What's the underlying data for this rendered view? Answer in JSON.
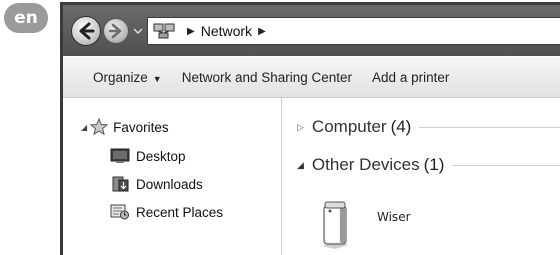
{
  "badge": {
    "language": "en"
  },
  "address_bar": {
    "crumbs": [
      "Network"
    ],
    "icons": [
      "back-arrow-icon",
      "forward-arrow-icon",
      "network-icon",
      "chevron-right-icon"
    ]
  },
  "toolbar": {
    "organize_label": "Organize",
    "network_center_label": "Network and Sharing Center",
    "add_printer_label": "Add a printer"
  },
  "nav_pane": {
    "favorites_label": "Favorites",
    "items": [
      {
        "label": "Desktop",
        "icon": "desktop-icon"
      },
      {
        "label": "Downloads",
        "icon": "downloads-icon"
      },
      {
        "label": "Recent Places",
        "icon": "recent-places-icon"
      }
    ]
  },
  "content": {
    "groups": [
      {
        "label": "Computer",
        "count": "(4)",
        "expanded": false
      },
      {
        "label": "Other Devices",
        "count": "(1)",
        "expanded": true
      }
    ],
    "device": {
      "name": "Wiser",
      "icon": "network-device-icon"
    }
  }
}
